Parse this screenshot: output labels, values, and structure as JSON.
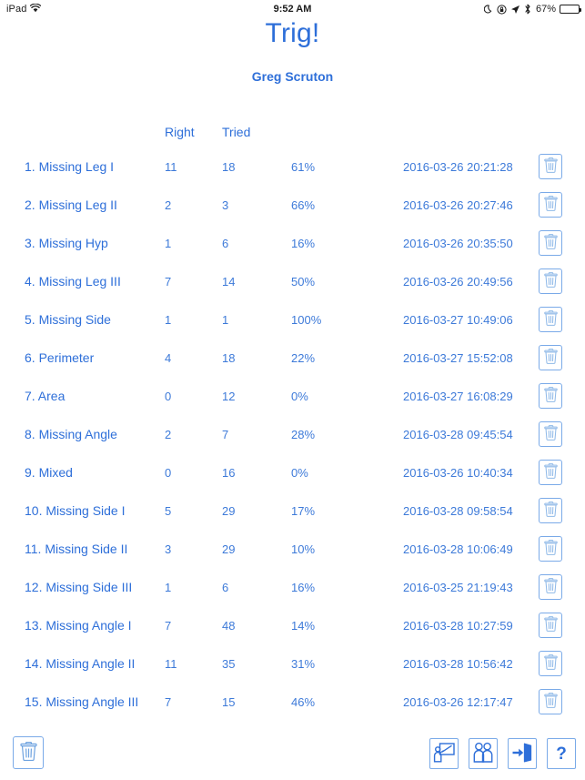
{
  "status_bar": {
    "carrier": "iPad",
    "wifi_icon": "wifi-icon",
    "time": "9:52 AM",
    "do_not_disturb_icon": "moon-icon",
    "rotation_lock_icon": "rotation-lock-icon",
    "location_icon": "location-arrow-icon",
    "bluetooth_icon": "bluetooth-icon",
    "battery_percent": "67%",
    "battery_level": 67
  },
  "header": {
    "title": "Trig!",
    "subtitle": "Greg Scruton",
    "accent_color": "#2e6fd9"
  },
  "table": {
    "columns": [
      "",
      "Right",
      "Tried",
      "",
      "",
      ""
    ],
    "header": {
      "right_label": "Right",
      "tried_label": "Tried"
    },
    "rows": [
      {
        "name": "1. Missing Leg I",
        "right": "11",
        "tried": "18",
        "percent": "61%",
        "date": "2016-03-26 20:21:28",
        "delete_icon": "trash-icon"
      },
      {
        "name": "2. Missing Leg II",
        "right": "2",
        "tried": "3",
        "percent": "66%",
        "date": "2016-03-26 20:27:46",
        "delete_icon": "trash-icon"
      },
      {
        "name": "3. Missing Hyp",
        "right": "1",
        "tried": "6",
        "percent": "16%",
        "date": "2016-03-26 20:35:50",
        "delete_icon": "trash-icon"
      },
      {
        "name": "4. Missing Leg III",
        "right": "7",
        "tried": "14",
        "percent": "50%",
        "date": "2016-03-26 20:49:56",
        "delete_icon": "trash-icon"
      },
      {
        "name": "5. Missing Side",
        "right": "1",
        "tried": "1",
        "percent": "100%",
        "date": "2016-03-27 10:49:06",
        "delete_icon": "trash-icon"
      },
      {
        "name": "6. Perimeter",
        "right": "4",
        "tried": "18",
        "percent": "22%",
        "date": "2016-03-27 15:52:08",
        "delete_icon": "trash-icon"
      },
      {
        "name": "7. Area",
        "right": "0",
        "tried": "12",
        "percent": "0%",
        "date": "2016-03-27 16:08:29",
        "delete_icon": "trash-icon"
      },
      {
        "name": "8. Missing Angle",
        "right": "2",
        "tried": "7",
        "percent": "28%",
        "date": "2016-03-28 09:45:54",
        "delete_icon": "trash-icon"
      },
      {
        "name": "9. Mixed",
        "right": "0",
        "tried": "16",
        "percent": "0%",
        "date": "2016-03-26 10:40:34",
        "delete_icon": "trash-icon"
      },
      {
        "name": "10. Missing Side I",
        "right": "5",
        "tried": "29",
        "percent": "17%",
        "date": "2016-03-28 09:58:54",
        "delete_icon": "trash-icon"
      },
      {
        "name": "11. Missing Side II",
        "right": "3",
        "tried": "29",
        "percent": "10%",
        "date": "2016-03-28 10:06:49",
        "delete_icon": "trash-icon"
      },
      {
        "name": "12. Missing Side III",
        "right": "1",
        "tried": "6",
        "percent": "16%",
        "date": "2016-03-25 21:19:43",
        "delete_icon": "trash-icon"
      },
      {
        "name": "13. Missing Angle I",
        "right": "7",
        "tried": "48",
        "percent": "14%",
        "date": "2016-03-28 10:27:59",
        "delete_icon": "trash-icon"
      },
      {
        "name": "14. Missing Angle II",
        "right": "11",
        "tried": "35",
        "percent": "31%",
        "date": "2016-03-28 10:56:42",
        "delete_icon": "trash-icon"
      },
      {
        "name": "15. Missing Angle III",
        "right": "7",
        "tried": "15",
        "percent": "46%",
        "date": "2016-03-26 12:17:47",
        "delete_icon": "trash-icon"
      }
    ]
  },
  "toolbar": {
    "delete_all_icon": "trash-icon",
    "teacher_icon": "teacher-whiteboard-icon",
    "students_icon": "students-group-icon",
    "exit_icon": "exit-door-icon",
    "help_label": "?"
  }
}
